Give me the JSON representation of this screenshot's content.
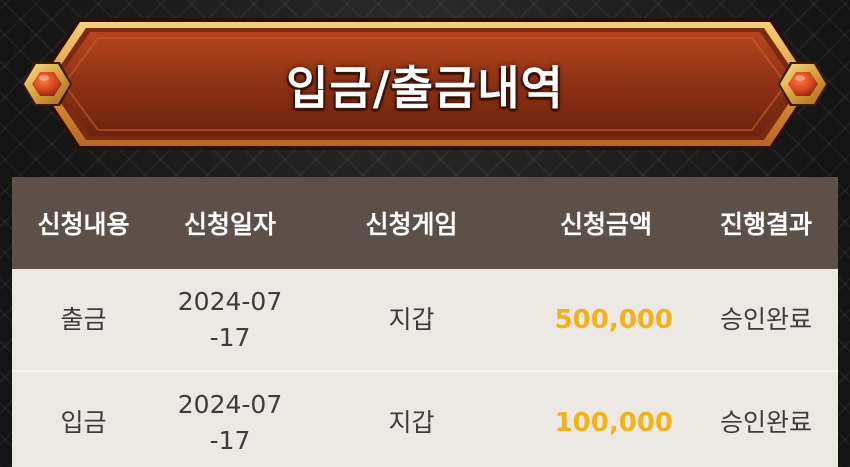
{
  "header": {
    "title": "입금/출금내역"
  },
  "table": {
    "columns": [
      "신청내용",
      "신청일자",
      "신청게임",
      "신청금액",
      "진행결과"
    ],
    "rows": [
      {
        "type": "출금",
        "date": "2024-07-17",
        "game": "지갑",
        "amount": "500,000",
        "result": "승인완료"
      },
      {
        "type": "입금",
        "date": "2024-07-17",
        "game": "지갑",
        "amount": "100,000",
        "result": "승인완료"
      }
    ]
  },
  "colors": {
    "banner_fill": "#8a2f14",
    "banner_border": "#e8a24a",
    "header_bg": "#5c5048",
    "row_bg": "#ece8e3",
    "amount": "#f2b21b",
    "gem": "#d2461e"
  }
}
